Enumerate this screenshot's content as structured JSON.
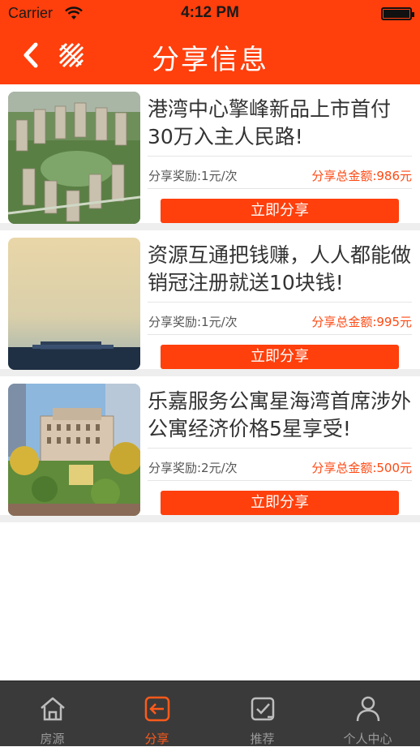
{
  "status_bar": {
    "carrier": "Carrier",
    "time": "4:12 PM"
  },
  "header": {
    "title": "分享信息"
  },
  "colors": {
    "brand": "#ff3f0c",
    "accent_text": "#ff4a14",
    "tabbar_bg": "#3a3a3a"
  },
  "items": [
    {
      "title": "港湾中心擎峰新品上市首付30万入主人民路!",
      "reward": "分享奖励:1元/次",
      "total": "分享总金额:986元",
      "button": "立即分享",
      "image": "residential-towers-aerial"
    },
    {
      "title": "资源互通把钱赚，人人都能做销冠注册就送10块钱!",
      "reward": "分享奖励:1元/次",
      "total": "分享总金额:995元",
      "button": "立即分享",
      "image": "horizon-skyline"
    },
    {
      "title": "乐嘉服务公寓星海湾首席涉外公寓经济价格5星享受!",
      "reward": "分享奖励:2元/次",
      "total": "分享总金额:500元",
      "button": "立即分享",
      "image": "apartment-garden"
    }
  ],
  "tabs": [
    {
      "label": "房源",
      "icon": "house-icon",
      "active": false
    },
    {
      "label": "分享",
      "icon": "share-icon",
      "active": true
    },
    {
      "label": "推荐",
      "icon": "check-icon",
      "active": false
    },
    {
      "label": "个人中心",
      "icon": "person-icon",
      "active": false
    }
  ]
}
